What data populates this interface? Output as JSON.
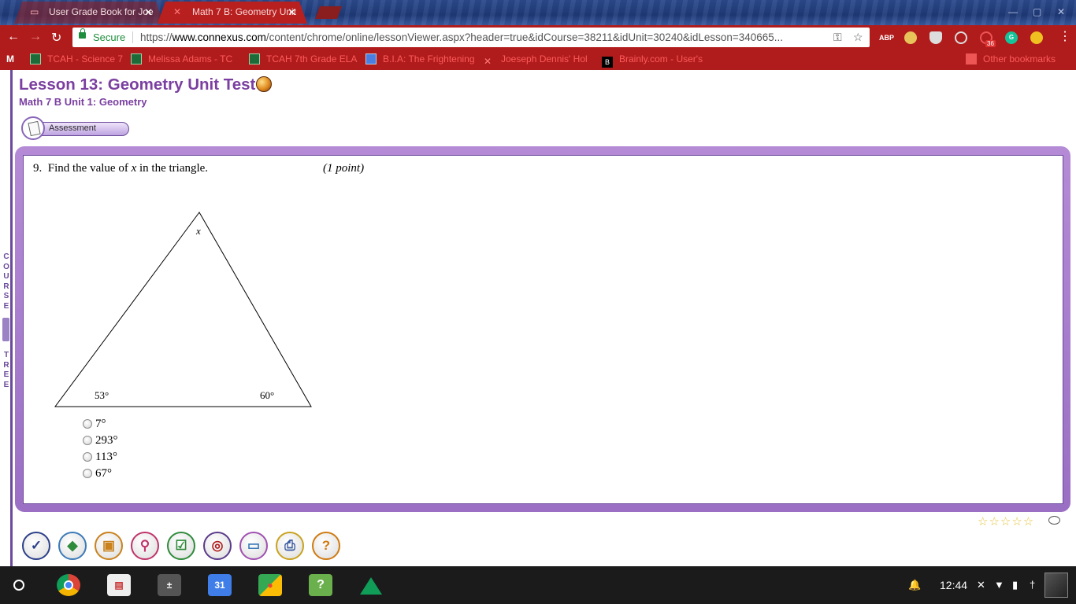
{
  "browser": {
    "tabs": [
      {
        "label": "User Grade Book for Joe",
        "active": false
      },
      {
        "label": "Math 7 B: Geometry Unit",
        "active": true
      }
    ],
    "address": {
      "secure_label": "Secure",
      "url_scheme": "https://",
      "url_host": "www.connexus.com",
      "url_path": "/content/chrome/online/lessonViewer.aspx?header=true&idCourse=38211&idUnit=30240&idLesson=340665..."
    },
    "extensions": {
      "abp": "ABP",
      "badge_count": "36"
    },
    "bookmarks": [
      "TCAH - Science 7",
      "Melissa Adams - TC",
      "TCAH 7th Grade ELA",
      "B.I.A: The Frightening",
      "Joeseph Dennis' Hol",
      "Brainly.com - User's"
    ],
    "other_bookmarks": "Other bookmarks"
  },
  "page": {
    "course_tree_label": "COURSE TREE",
    "lesson_title": "Lesson 13: Geometry Unit Test",
    "subtitle": "Math 7 B  Unit 1: Geometry",
    "mode_label": "Assessment"
  },
  "question": {
    "number": "9.",
    "prompt_before": "Find the value of",
    "variable": "x",
    "prompt_after": "in the triangle.",
    "points": "(1 point)",
    "figure": {
      "top_label": "x",
      "left_angle": "53°",
      "right_angle": "60°"
    },
    "options": [
      "7°",
      "293°",
      "113°",
      "67°"
    ],
    "selected": null
  },
  "toolbar_icons": [
    "check-icon",
    "book-icon",
    "backpack-icon",
    "pushpin-icon",
    "checklist-icon",
    "target-icon",
    "screen-icon",
    "printer-icon",
    "help-icon"
  ],
  "rating": {
    "stars_filled": 0,
    "stars_total": 5
  },
  "shelf": {
    "apps": [
      "chrome-icon",
      "files-icon",
      "calculator-icon",
      "calendar-icon",
      "maps-icon",
      "help-app-icon",
      "drive-icon"
    ],
    "calendar_day": "31",
    "help_app_glyph": "?",
    "time": "12:44"
  },
  "colors": {
    "chrome_red": "#b01c1c",
    "title_purple": "#7a3fa0",
    "frame_purple": "#9a6fc4",
    "shelf_bg": "#1b1b1b"
  }
}
